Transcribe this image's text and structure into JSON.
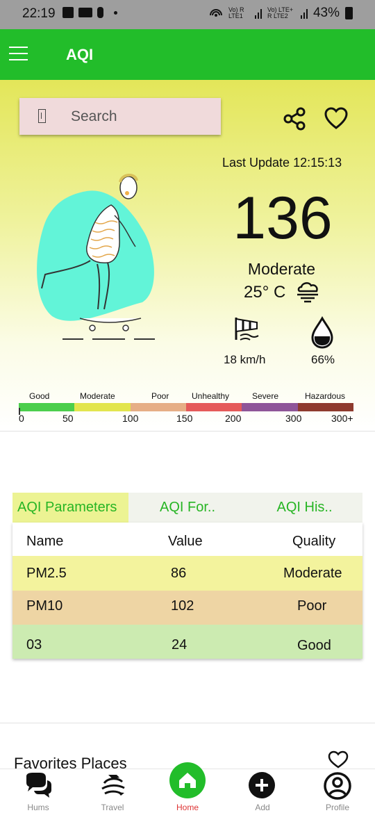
{
  "status_bar": {
    "time": "22:19",
    "network_1": "Vo) R LTE1",
    "network_2": "Vo) LTE+ R LTE2",
    "battery": "43%"
  },
  "app_bar": {
    "title": "AQI",
    "menu_icon": "hamburger-icon"
  },
  "search": {
    "placeholder": "Search"
  },
  "header_icons": [
    "share-icon",
    "heart-icon"
  ],
  "current": {
    "last_update": "Last Update 12:15:13",
    "aqi": "136",
    "category": "Moderate",
    "temperature": "25° C",
    "weather_icon": "cloud-wind-icon",
    "wind_icon": "windsock-icon",
    "wind_speed": "18 km/h",
    "humidity_icon": "water-drop-icon",
    "humidity": "66%"
  },
  "aqi_scale": {
    "labels": [
      "Good",
      "Moderate",
      "Poor",
      "Unhealthy",
      "Severe",
      "Hazardous"
    ],
    "colors": [
      "#4cce4c",
      "#e2e54d",
      "#e6ae86",
      "#e55a5a",
      "#8e5598",
      "#8e3a2e"
    ],
    "numbers": [
      "0",
      "50",
      "100",
      "150",
      "200",
      "300",
      "300+"
    ]
  },
  "tabs": [
    {
      "label": "AQI Parameters",
      "active": true
    },
    {
      "label": "AQI For..",
      "active": false
    },
    {
      "label": "AQI His..",
      "active": false
    }
  ],
  "table": {
    "headers": [
      "Name",
      "Value",
      "Quality"
    ],
    "rows": [
      {
        "name": "PM2.5",
        "value": "86",
        "quality": "Moderate",
        "color": "#f3f39d"
      },
      {
        "name": "PM10",
        "value": "102",
        "quality": "Poor",
        "color": "#eed5a4"
      },
      {
        "name": "03",
        "value": "24",
        "quality": "Good",
        "color": "#ccebb1"
      }
    ]
  },
  "favorites": {
    "title": "Favorites Places"
  },
  "bottom_nav": [
    {
      "label": "Hums",
      "icon": "chat-bubbles-icon"
    },
    {
      "label": "Travel",
      "icon": "globe-plane-icon"
    },
    {
      "label": "Home",
      "icon": "home-icon",
      "active": true
    },
    {
      "label": "Add",
      "icon": "add-icon"
    },
    {
      "label": "Profile",
      "icon": "profile-icon"
    }
  ],
  "colors": {
    "accent": "#22bd2a",
    "active_nav": "#dd3333"
  }
}
